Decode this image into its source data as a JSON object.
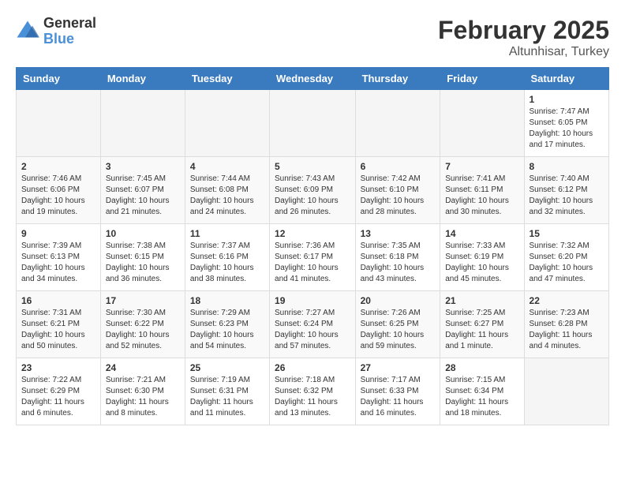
{
  "header": {
    "logo_general": "General",
    "logo_blue": "Blue",
    "month_title": "February 2025",
    "location": "Altunhisar, Turkey"
  },
  "days_of_week": [
    "Sunday",
    "Monday",
    "Tuesday",
    "Wednesday",
    "Thursday",
    "Friday",
    "Saturday"
  ],
  "weeks": [
    [
      {
        "day": "",
        "info": ""
      },
      {
        "day": "",
        "info": ""
      },
      {
        "day": "",
        "info": ""
      },
      {
        "day": "",
        "info": ""
      },
      {
        "day": "",
        "info": ""
      },
      {
        "day": "",
        "info": ""
      },
      {
        "day": "1",
        "info": "Sunrise: 7:47 AM\nSunset: 6:05 PM\nDaylight: 10 hours\nand 17 minutes."
      }
    ],
    [
      {
        "day": "2",
        "info": "Sunrise: 7:46 AM\nSunset: 6:06 PM\nDaylight: 10 hours\nand 19 minutes."
      },
      {
        "day": "3",
        "info": "Sunrise: 7:45 AM\nSunset: 6:07 PM\nDaylight: 10 hours\nand 21 minutes."
      },
      {
        "day": "4",
        "info": "Sunrise: 7:44 AM\nSunset: 6:08 PM\nDaylight: 10 hours\nand 24 minutes."
      },
      {
        "day": "5",
        "info": "Sunrise: 7:43 AM\nSunset: 6:09 PM\nDaylight: 10 hours\nand 26 minutes."
      },
      {
        "day": "6",
        "info": "Sunrise: 7:42 AM\nSunset: 6:10 PM\nDaylight: 10 hours\nand 28 minutes."
      },
      {
        "day": "7",
        "info": "Sunrise: 7:41 AM\nSunset: 6:11 PM\nDaylight: 10 hours\nand 30 minutes."
      },
      {
        "day": "8",
        "info": "Sunrise: 7:40 AM\nSunset: 6:12 PM\nDaylight: 10 hours\nand 32 minutes."
      }
    ],
    [
      {
        "day": "9",
        "info": "Sunrise: 7:39 AM\nSunset: 6:13 PM\nDaylight: 10 hours\nand 34 minutes."
      },
      {
        "day": "10",
        "info": "Sunrise: 7:38 AM\nSunset: 6:15 PM\nDaylight: 10 hours\nand 36 minutes."
      },
      {
        "day": "11",
        "info": "Sunrise: 7:37 AM\nSunset: 6:16 PM\nDaylight: 10 hours\nand 38 minutes."
      },
      {
        "day": "12",
        "info": "Sunrise: 7:36 AM\nSunset: 6:17 PM\nDaylight: 10 hours\nand 41 minutes."
      },
      {
        "day": "13",
        "info": "Sunrise: 7:35 AM\nSunset: 6:18 PM\nDaylight: 10 hours\nand 43 minutes."
      },
      {
        "day": "14",
        "info": "Sunrise: 7:33 AM\nSunset: 6:19 PM\nDaylight: 10 hours\nand 45 minutes."
      },
      {
        "day": "15",
        "info": "Sunrise: 7:32 AM\nSunset: 6:20 PM\nDaylight: 10 hours\nand 47 minutes."
      }
    ],
    [
      {
        "day": "16",
        "info": "Sunrise: 7:31 AM\nSunset: 6:21 PM\nDaylight: 10 hours\nand 50 minutes."
      },
      {
        "day": "17",
        "info": "Sunrise: 7:30 AM\nSunset: 6:22 PM\nDaylight: 10 hours\nand 52 minutes."
      },
      {
        "day": "18",
        "info": "Sunrise: 7:29 AM\nSunset: 6:23 PM\nDaylight: 10 hours\nand 54 minutes."
      },
      {
        "day": "19",
        "info": "Sunrise: 7:27 AM\nSunset: 6:24 PM\nDaylight: 10 hours\nand 57 minutes."
      },
      {
        "day": "20",
        "info": "Sunrise: 7:26 AM\nSunset: 6:25 PM\nDaylight: 10 hours\nand 59 minutes."
      },
      {
        "day": "21",
        "info": "Sunrise: 7:25 AM\nSunset: 6:27 PM\nDaylight: 11 hours\nand 1 minute."
      },
      {
        "day": "22",
        "info": "Sunrise: 7:23 AM\nSunset: 6:28 PM\nDaylight: 11 hours\nand 4 minutes."
      }
    ],
    [
      {
        "day": "23",
        "info": "Sunrise: 7:22 AM\nSunset: 6:29 PM\nDaylight: 11 hours\nand 6 minutes."
      },
      {
        "day": "24",
        "info": "Sunrise: 7:21 AM\nSunset: 6:30 PM\nDaylight: 11 hours\nand 8 minutes."
      },
      {
        "day": "25",
        "info": "Sunrise: 7:19 AM\nSunset: 6:31 PM\nDaylight: 11 hours\nand 11 minutes."
      },
      {
        "day": "26",
        "info": "Sunrise: 7:18 AM\nSunset: 6:32 PM\nDaylight: 11 hours\nand 13 minutes."
      },
      {
        "day": "27",
        "info": "Sunrise: 7:17 AM\nSunset: 6:33 PM\nDaylight: 11 hours\nand 16 minutes."
      },
      {
        "day": "28",
        "info": "Sunrise: 7:15 AM\nSunset: 6:34 PM\nDaylight: 11 hours\nand 18 minutes."
      },
      {
        "day": "",
        "info": ""
      }
    ]
  ]
}
